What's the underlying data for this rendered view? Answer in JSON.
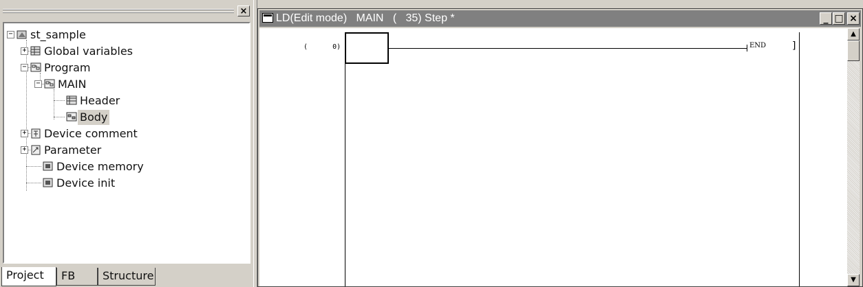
{
  "left_pane": {
    "close_label": "×",
    "tree": [
      {
        "label": "st_sample",
        "icon": "project-icon",
        "expander": "−"
      },
      {
        "label": "Global variables",
        "icon": "table-icon",
        "expander": "+"
      },
      {
        "label": "Program",
        "icon": "program-icon",
        "expander": "−"
      },
      {
        "label": "MAIN",
        "icon": "program-icon",
        "expander": "−"
      },
      {
        "label": "Header",
        "icon": "header-icon"
      },
      {
        "label": "Body",
        "icon": "body-icon",
        "selected": true
      },
      {
        "label": "Device comment",
        "icon": "device-comment-icon",
        "expander": "+"
      },
      {
        "label": "Parameter",
        "icon": "parameter-icon",
        "expander": "+"
      },
      {
        "label": "Device memory",
        "icon": "device-memory-icon"
      },
      {
        "label": "Device init",
        "icon": "device-init-icon"
      }
    ],
    "tabs": [
      {
        "label": "Project",
        "active": true
      },
      {
        "label": "FB",
        "active": false
      },
      {
        "label": "Structure",
        "active": false
      }
    ]
  },
  "editor": {
    "title": "LD(Edit mode)   MAIN   (   35) Step *",
    "minimize_label": "_",
    "maximize_label": "□",
    "close_label": "×",
    "step_label": "(      0)",
    "end_instruction": "END",
    "scroll_up": "▲",
    "scroll_down": "▼"
  }
}
